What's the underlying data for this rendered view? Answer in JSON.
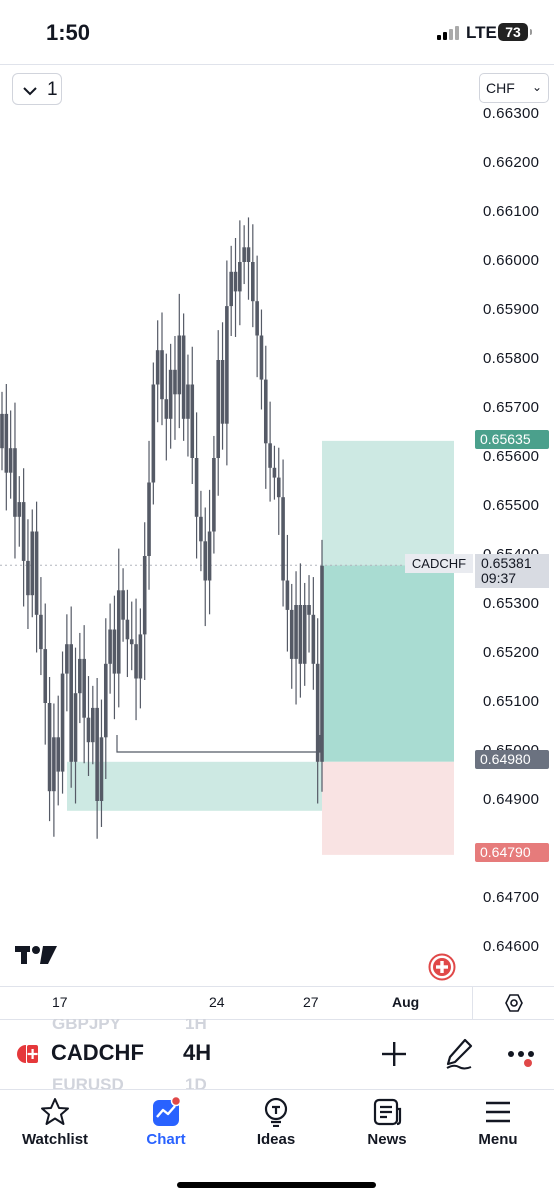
{
  "status": {
    "time": "1:50",
    "network": "LTE",
    "battery": "73"
  },
  "toolbar": {
    "layout_count": "1",
    "currency": "CHF"
  },
  "price_axis": [
    "0.66300",
    "0.66200",
    "0.66100",
    "0.66000",
    "0.65900",
    "0.65800",
    "0.65700",
    "0.65600",
    "0.65500",
    "0.65400",
    "0.65300",
    "0.65200",
    "0.65100",
    "0.65000",
    "0.64900",
    "0.64800",
    "0.64700",
    "0.64600"
  ],
  "position": {
    "take_profit": "0.65635",
    "entry": "0.64980",
    "stop_loss": "0.64790"
  },
  "current": {
    "symbol": "CADCHF",
    "price": "0.65381",
    "countdown": "09:37"
  },
  "time_axis": [
    "17",
    "24",
    "27",
    "Aug"
  ],
  "symbol_bar": {
    "symbol": "CADCHF",
    "interval": "4H",
    "ghost_above": {
      "symbol": "GBPJPY",
      "interval": "1H"
    },
    "ghost_below": {
      "symbol": "EURUSD",
      "interval": "1D"
    }
  },
  "nav": [
    {
      "label": "Watchlist",
      "icon": "star-icon"
    },
    {
      "label": "Chart",
      "icon": "chart-icon",
      "active": true
    },
    {
      "label": "Ideas",
      "icon": "lightbulb-icon"
    },
    {
      "label": "News",
      "icon": "newspaper-icon"
    },
    {
      "label": "Menu",
      "icon": "hamburger-icon"
    }
  ],
  "colors": {
    "candle": "#555a66",
    "tp_zone": "#cde9e3",
    "tp_zone_filled": "#a9dcd2",
    "sl_zone": "#f9e3e3",
    "accent": "#2962ff",
    "tp_badge": "#4ba08c",
    "sl_badge": "#e67b7b"
  },
  "chart_data": {
    "type": "candlestick",
    "symbol": "CADCHF",
    "interval": "4H",
    "y_range": [
      0.6459,
      0.6631
    ],
    "x_ticks": [
      "17",
      "24",
      "27",
      "Aug"
    ],
    "closes": [
      0.6569,
      0.6557,
      0.6562,
      0.6548,
      0.6551,
      0.6539,
      0.6532,
      0.6545,
      0.6528,
      0.6521,
      0.651,
      0.6492,
      0.6503,
      0.6496,
      0.6516,
      0.6522,
      0.6498,
      0.6512,
      0.6519,
      0.6507,
      0.6502,
      0.6509,
      0.649,
      0.6503,
      0.6518,
      0.6525,
      0.6516,
      0.6533,
      0.6527,
      0.6523,
      0.6522,
      0.6515,
      0.6524,
      0.654,
      0.6555,
      0.6575,
      0.6582,
      0.6572,
      0.6568,
      0.6578,
      0.6573,
      0.6585,
      0.6568,
      0.6575,
      0.656,
      0.6548,
      0.6543,
      0.6535,
      0.6545,
      0.656,
      0.658,
      0.6567,
      0.6591,
      0.6598,
      0.6594,
      0.66,
      0.6603,
      0.66,
      0.6592,
      0.6585,
      0.6576,
      0.6563,
      0.6558,
      0.6556,
      0.6552,
      0.6535,
      0.6529,
      0.6519,
      0.653,
      0.6518,
      0.653,
      0.6528,
      0.6518,
      0.6498,
      0.6538
    ],
    "position": {
      "take_profit": 0.65635,
      "entry": 0.6498,
      "stop_loss": 0.6479
    },
    "demand_zone": [
      0.6488,
      0.6498
    ],
    "current_price": 0.65381
  }
}
